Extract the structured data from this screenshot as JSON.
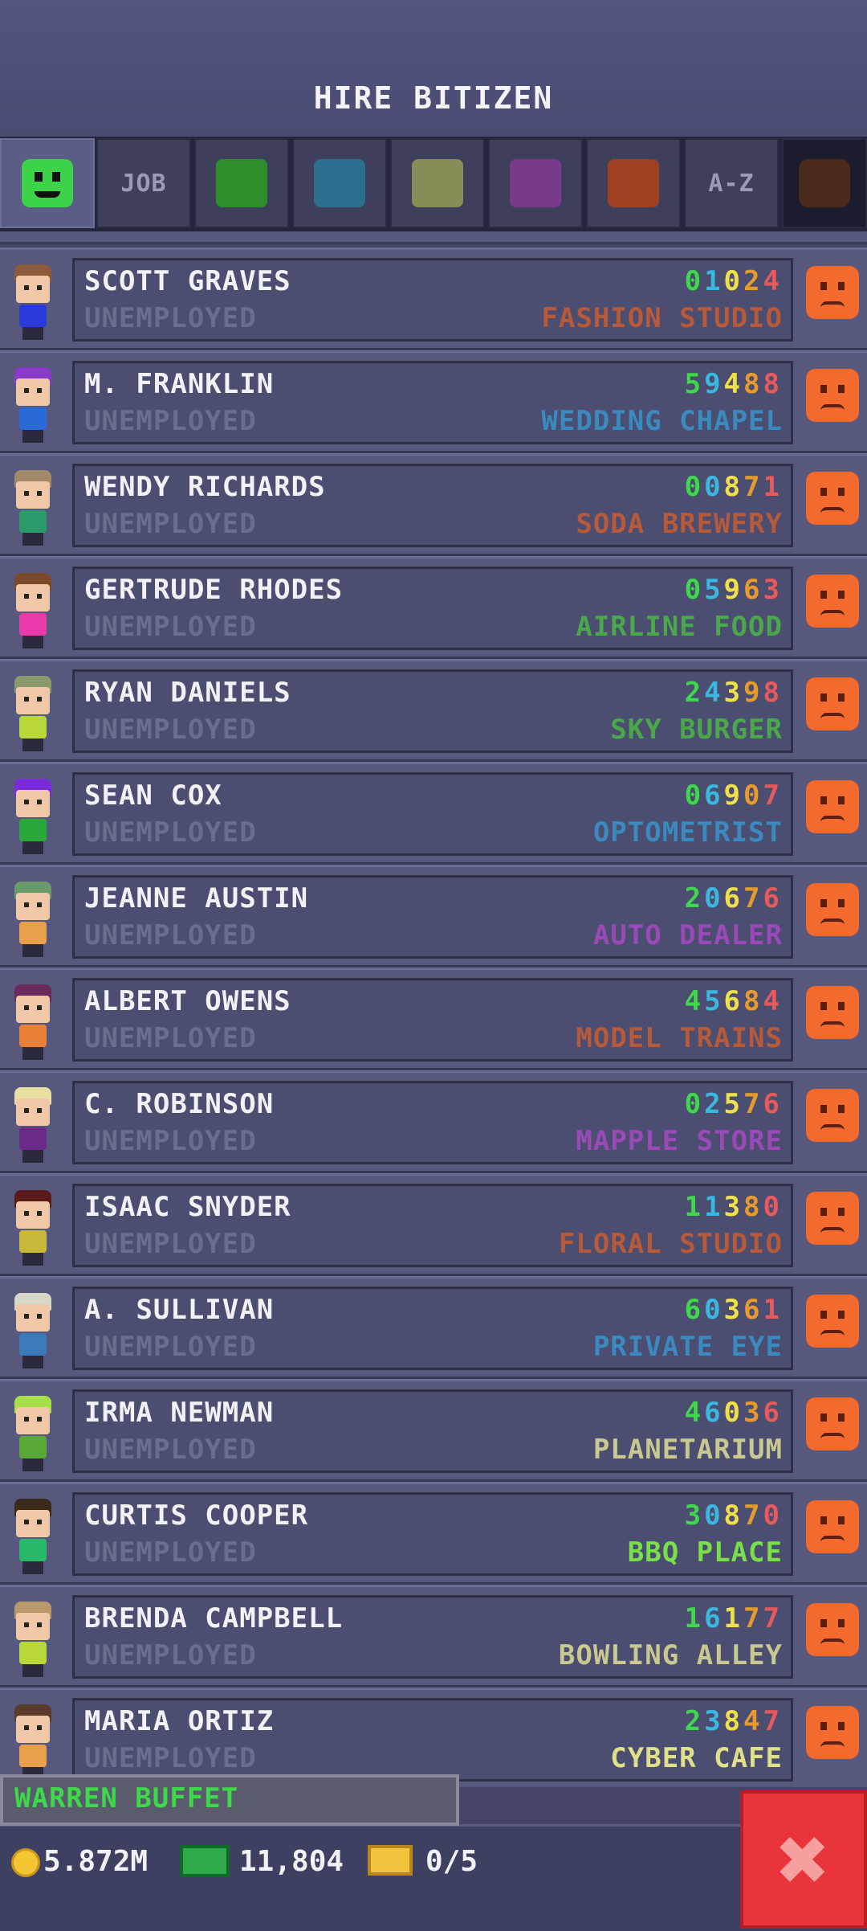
{
  "header": {
    "title": "HIRE BITIZEN"
  },
  "tabs": [
    {
      "type": "icon",
      "icon": "smiley-icon",
      "color": "#3cd24a",
      "active": true
    },
    {
      "type": "label",
      "label": "JOB"
    },
    {
      "type": "swatch",
      "color": "#2e8f2a"
    },
    {
      "type": "swatch",
      "color": "#2c6e8c"
    },
    {
      "type": "swatch",
      "color": "#8a8c58"
    },
    {
      "type": "swatch",
      "color": "#7a3a8c"
    },
    {
      "type": "swatch",
      "color": "#a04022"
    },
    {
      "type": "label",
      "label": "A-Z"
    }
  ],
  "bitizens": [
    {
      "name": "SCOTT GRAVES",
      "status": "UNEMPLOYED",
      "skills": "01024",
      "dream_job": "FASHION STUDIO",
      "dream_color": "#b65a3a",
      "hair": "#8a5a3a",
      "shirt": "#2a3ad8"
    },
    {
      "name": "M. FRANKLIN",
      "status": "UNEMPLOYED",
      "skills": "59488",
      "dream_job": "WEDDING CHAPEL",
      "dream_color": "#3a8ac0",
      "hair": "#8a3ac8",
      "shirt": "#2a6ad8"
    },
    {
      "name": "WENDY RICHARDS",
      "status": "UNEMPLOYED",
      "skills": "00871",
      "dream_job": "SODA BREWERY",
      "dream_color": "#b65a3a",
      "hair": "#a08a6a",
      "shirt": "#2a9a6a"
    },
    {
      "name": "GERTRUDE RHODES",
      "status": "UNEMPLOYED",
      "skills": "05963",
      "dream_job": "AIRLINE FOOD",
      "dream_color": "#4aa84a",
      "hair": "#7a4a2a",
      "shirt": "#e83aa8"
    },
    {
      "name": "RYAN DANIELS",
      "status": "UNEMPLOYED",
      "skills": "24398",
      "dream_job": "SKY BURGER",
      "dream_color": "#4aa84a",
      "hair": "#8a9a6a",
      "shirt": "#b8d83a"
    },
    {
      "name": "SEAN COX",
      "status": "UNEMPLOYED",
      "skills": "06907",
      "dream_job": "OPTOMETRIST",
      "dream_color": "#3a8ac0",
      "hair": "#7a2ad8",
      "shirt": "#2aa83a"
    },
    {
      "name": "JEANNE AUSTIN",
      "status": "UNEMPLOYED",
      "skills": "20676",
      "dream_job": "AUTO DEALER",
      "dream_color": "#9a4ab8",
      "hair": "#6a9a6a",
      "shirt": "#e8a04a"
    },
    {
      "name": "ALBERT OWENS",
      "status": "UNEMPLOYED",
      "skills": "45684",
      "dream_job": "MODEL TRAINS",
      "dream_color": "#b65a3a",
      "hair": "#6a2a5a",
      "shirt": "#e8803a"
    },
    {
      "name": "C. ROBINSON",
      "status": "UNEMPLOYED",
      "skills": "02576",
      "dream_job": "MAPPLE STORE",
      "dream_color": "#9a4ab8",
      "hair": "#e8e0a0",
      "shirt": "#6a2a8a"
    },
    {
      "name": "ISAAC SNYDER",
      "status": "UNEMPLOYED",
      "skills": "11380",
      "dream_job": "FLORAL STUDIO",
      "dream_color": "#b65a3a",
      "hair": "#5a1a1a",
      "shirt": "#c8b83a"
    },
    {
      "name": "A. SULLIVAN",
      "status": "UNEMPLOYED",
      "skills": "60361",
      "dream_job": "PRIVATE EYE",
      "dream_color": "#3a8ac0",
      "hair": "#d8d8c8",
      "shirt": "#3a7ab8"
    },
    {
      "name": "IRMA NEWMAN",
      "status": "UNEMPLOYED",
      "skills": "46036",
      "dream_job": "PLANETARIUM",
      "dream_color": "#c8c890",
      "hair": "#a8e04a",
      "shirt": "#5aa83a"
    },
    {
      "name": "CURTIS COOPER",
      "status": "UNEMPLOYED",
      "skills": "30870",
      "dream_job": "BBQ PLACE",
      "dream_color": "#7ae04a",
      "hair": "#3a2a1a",
      "shirt": "#2ab86a"
    },
    {
      "name": "BRENDA CAMPBELL",
      "status": "UNEMPLOYED",
      "skills": "16177",
      "dream_job": "BOWLING ALLEY",
      "dream_color": "#c8c890",
      "hair": "#b89a6a",
      "shirt": "#b8d83a"
    },
    {
      "name": "MARIA ORTIZ",
      "status": "UNEMPLOYED",
      "skills": "23847",
      "dream_job": "CYBER CAFE",
      "dream_color": "#e0e08a",
      "hair": "#5a3a2a",
      "shirt": "#e8a04a"
    }
  ],
  "selected": {
    "name": "WARREN BUFFET"
  },
  "footer": {
    "coins": "5.872M",
    "cash": "11,804",
    "bux": "0/5"
  },
  "colors": {
    "mood_unhappy": "#f26a2e",
    "close": "#e8343a"
  }
}
